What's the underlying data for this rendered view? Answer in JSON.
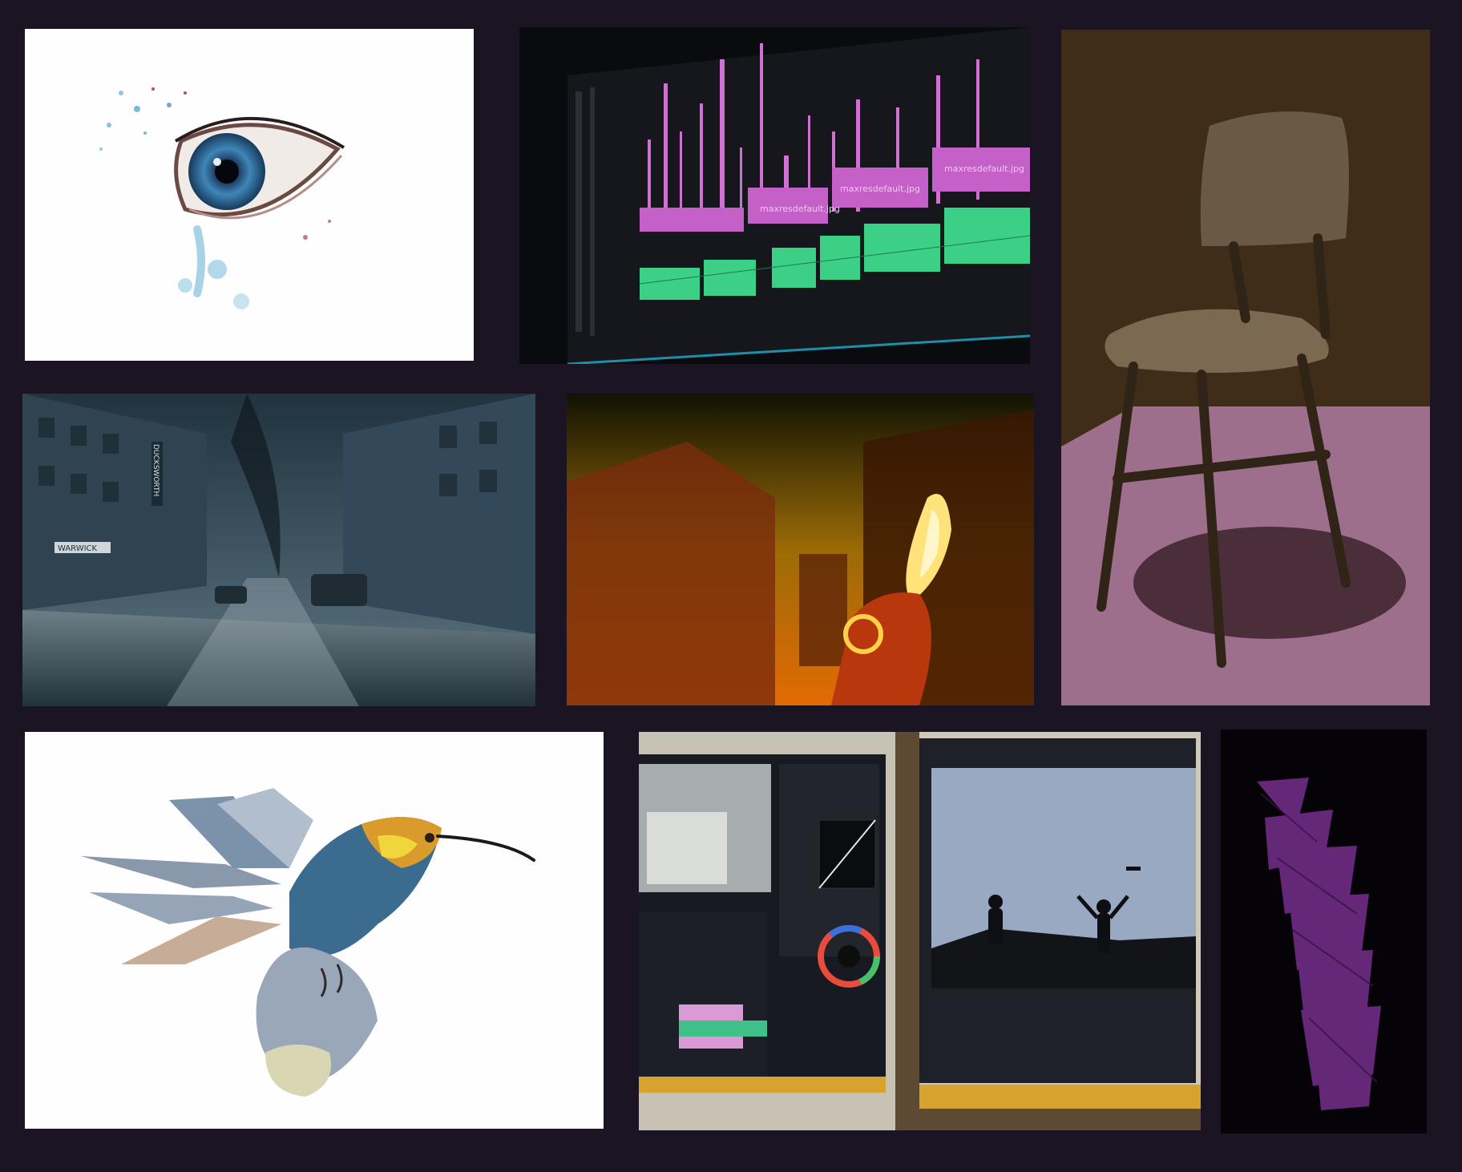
{
  "board": {
    "background": "#1b1423",
    "tiles": [
      {
        "name": "watercolor-eye-artwork"
      },
      {
        "name": "video-editing-timeline-screen",
        "clips": [
          "maxresdefault.jpg",
          "maxresdefault.jpg",
          "maxresdefault.jpg"
        ]
      },
      {
        "name": "3d-wooden-chair-render"
      },
      {
        "name": "stormy-city-street-photo",
        "signs": [
          "WARWICK",
          "DUCKSWORTH"
        ]
      },
      {
        "name": "game-first-person-scene"
      },
      {
        "name": "low-poly-hummingbird-illustration"
      },
      {
        "name": "dual-monitor-editing-photo"
      },
      {
        "name": "purple-typography-poster"
      }
    ]
  }
}
